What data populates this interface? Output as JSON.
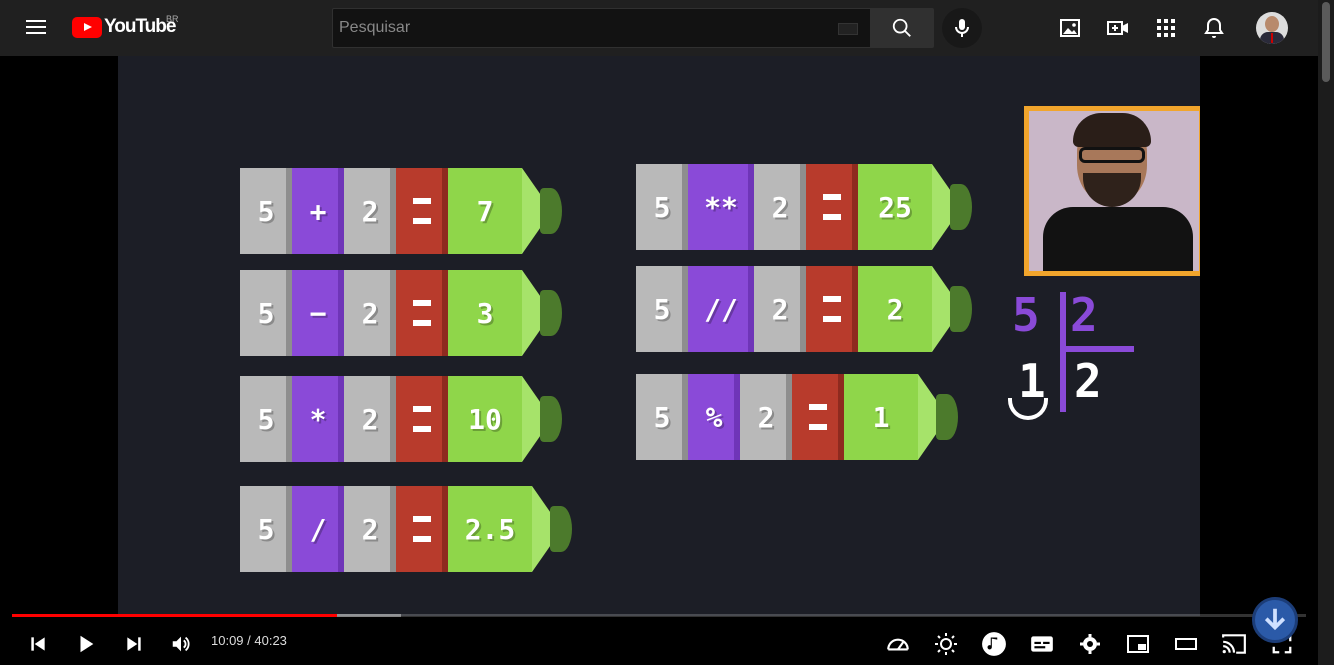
{
  "header": {
    "logo_text": "YouTube",
    "country_code": "BR",
    "search_placeholder": "Pesquisar",
    "icons": [
      "menu-icon",
      "search-icon",
      "mic-icon",
      "image-icon",
      "create-video-icon",
      "apps-grid-icon",
      "bell-icon"
    ]
  },
  "video": {
    "operations_left": [
      {
        "a": "5",
        "op": "+",
        "b": "2",
        "result": "7"
      },
      {
        "a": "5",
        "op": "−",
        "b": "2",
        "result": "3"
      },
      {
        "a": "5",
        "op": "*",
        "b": "2",
        "result": "10"
      },
      {
        "a": "5",
        "op": "/",
        "b": "2",
        "result": "2.5"
      }
    ],
    "operations_right": [
      {
        "a": "5",
        "op": "**",
        "b": "2",
        "result": "25"
      },
      {
        "a": "5",
        "op": "//",
        "b": "2",
        "result": "2"
      },
      {
        "a": "5",
        "op": "%",
        "b": "2",
        "result": "1"
      }
    ],
    "division": {
      "dividend": "5",
      "divisor": "2",
      "remainder": "1",
      "quotient": "2"
    }
  },
  "player": {
    "current_time": "10:09",
    "separator": " / ",
    "duration": "40:23",
    "time_display": "10:09 / 40:23",
    "played_fraction": 0.251,
    "buffered_fraction": 0.301,
    "accent_color": "#ff0000"
  }
}
